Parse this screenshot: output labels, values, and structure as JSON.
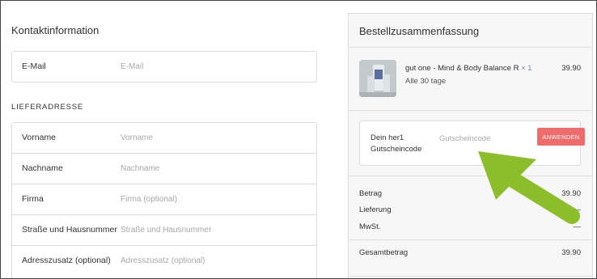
{
  "contact": {
    "title": "Kontaktinformation",
    "email_label": "E-Mail",
    "email_placeholder": "E-Mail"
  },
  "shipping": {
    "title": "LIEFERADRESSE",
    "fields": [
      {
        "label": "Vorname",
        "placeholder": "Vorname"
      },
      {
        "label": "Nachname",
        "placeholder": "Nachname"
      },
      {
        "label": "Firma",
        "placeholder": "Firma (optional)"
      },
      {
        "label": "Straße und Hausnummer",
        "placeholder": "Straße und Hausnummer"
      },
      {
        "label": "Adresszusatz (optional)",
        "placeholder": "Adresszusatz (optional)"
      }
    ]
  },
  "summary": {
    "title": "Bestellzusammenfassung",
    "product": {
      "name": "gut one - Mind & Body Balance R",
      "qty": "× 1",
      "subtitle": "Alle 30 tage",
      "price": "39.90"
    },
    "coupon": {
      "label": "Dein her1 Gutscheincode",
      "placeholder": "Gutscheincode",
      "button": "ANWENDEN"
    },
    "totals": {
      "betrag_label": "Betrag",
      "betrag_value": "39.90",
      "lieferung_label": "Lieferung",
      "lieferung_value": "—",
      "mwst_label": "MwSt.",
      "mwst_value": "—",
      "gesamt_label": "Gesamtbetrag",
      "gesamt_value": "39.90"
    }
  },
  "colors": {
    "accent_button": "#ef6c6c",
    "annotation_arrow": "#8cbd2a"
  }
}
